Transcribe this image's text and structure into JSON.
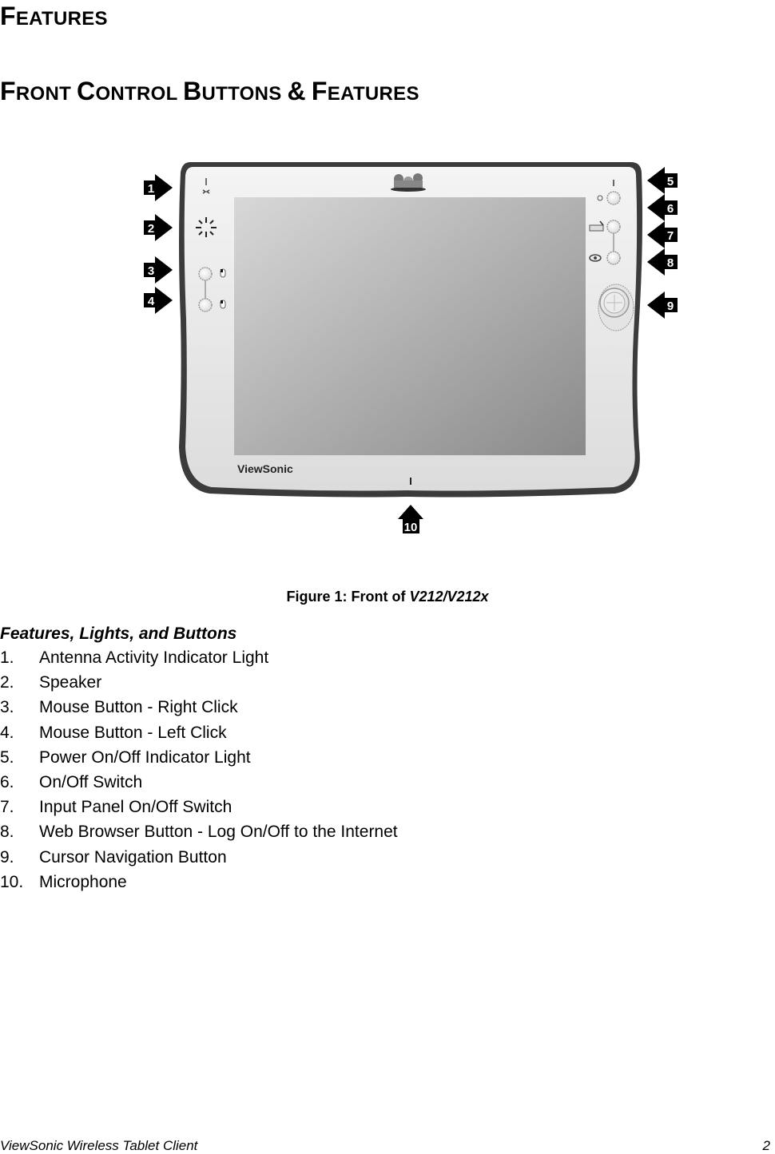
{
  "page": {
    "title": {
      "first": "F",
      "rest": "EATURES"
    },
    "section": {
      "words": [
        {
          "first": "F",
          "rest": "RONT"
        },
        {
          "first": "C",
          "rest": "ONTROL"
        },
        {
          "first": "B",
          "rest": "UTTONS"
        },
        {
          "first": "&",
          "rest": ""
        },
        {
          "first": "F",
          "rest": "EATURES"
        }
      ]
    }
  },
  "figure": {
    "brand_logo_text": "ViewSonic",
    "callouts": [
      "1",
      "2",
      "3",
      "4",
      "5",
      "6",
      "7",
      "8",
      "9",
      "10"
    ],
    "caption": {
      "prefix": "Figure 1: Front of ",
      "model": "V212/V212x"
    }
  },
  "features": {
    "heading": "Features, Lights, and Buttons",
    "items": [
      {
        "num": "1.",
        "label": "Antenna Activity Indicator Light"
      },
      {
        "num": "2.",
        "label": "Speaker"
      },
      {
        "num": "3.",
        "label": "Mouse Button - Right Click"
      },
      {
        "num": "4.",
        "label": "Mouse Button - Left Click"
      },
      {
        "num": "5.",
        "label": "Power On/Off Indicator Light"
      },
      {
        "num": "6.",
        "label": "On/Off Switch"
      },
      {
        "num": "7.",
        "label": "Input Panel On/Off Switch"
      },
      {
        "num": "8.",
        "label": "Web Browser Button - Log On/Off to the Internet"
      },
      {
        "num": "9.",
        "label": "Cursor Navigation Button"
      },
      {
        "num": "10.",
        "label": "Microphone"
      }
    ]
  },
  "footer": {
    "doc_title": "ViewSonic Wireless Tablet Client",
    "page_number": "2"
  }
}
